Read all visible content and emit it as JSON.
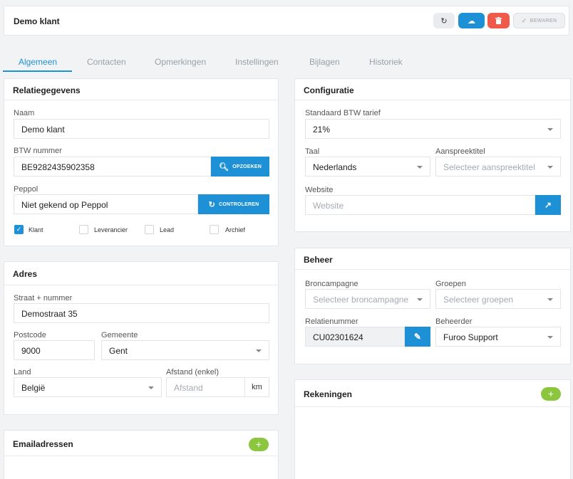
{
  "header": {
    "title": "Demo klant",
    "save_label": "BEWAREN",
    "colors": {
      "primary": "#1e90d6",
      "danger": "#f05a4a",
      "add": "#8cc63f"
    }
  },
  "tabs": [
    "Algemeen",
    "Contacten",
    "Opmerkingen",
    "Instellingen",
    "Bijlagen",
    "Historiek"
  ],
  "relatie": {
    "title": "Relatiegegevens",
    "naam_label": "Naam",
    "naam_value": "Demo klant",
    "btw_label": "BTW nummer",
    "btw_value": "BE9282435902358",
    "opzoeken_label": "OPZOEKEN",
    "peppol_label": "Peppol",
    "peppol_value": "Niet gekend op Peppol",
    "controleren_label": "CONTROLEREN",
    "checkboxes": [
      {
        "label": "Klant",
        "checked": true
      },
      {
        "label": "Leverancier",
        "checked": false
      },
      {
        "label": "Lead",
        "checked": false
      },
      {
        "label": "Archief",
        "checked": false
      }
    ]
  },
  "adres": {
    "title": "Adres",
    "straat_label": "Straat + nummer",
    "straat_value": "Demostraat 35",
    "postcode_label": "Postcode",
    "postcode_value": "9000",
    "gemeente_label": "Gemeente",
    "gemeente_value": "Gent",
    "land_label": "Land",
    "land_value": "België",
    "afstand_label": "Afstand (enkel)",
    "afstand_placeholder": "Afstand",
    "afstand_unit": "km"
  },
  "email": {
    "title": "Emailadressen"
  },
  "configuratie": {
    "title": "Configuratie",
    "btw_tarief_label": "Standaard BTW tarief",
    "btw_tarief_value": "21%",
    "taal_label": "Taal",
    "taal_value": "Nederlands",
    "aanspreek_label": "Aanspreektitel",
    "aanspreek_placeholder": "Selecteer aanspreektitel",
    "website_label": "Website",
    "website_placeholder": "Website"
  },
  "beheer": {
    "title": "Beheer",
    "broncampagne_label": "Broncampagne",
    "broncampagne_placeholder": "Selecteer broncampagne",
    "groepen_label": "Groepen",
    "groepen_placeholder": "Selecteer groepen",
    "relatienummer_label": "Relatienummer",
    "relatienummer_value": "CU02301624",
    "beheerder_label": "Beheerder",
    "beheerder_value": "Furoo Support"
  },
  "rekeningen": {
    "title": "Rekeningen"
  }
}
